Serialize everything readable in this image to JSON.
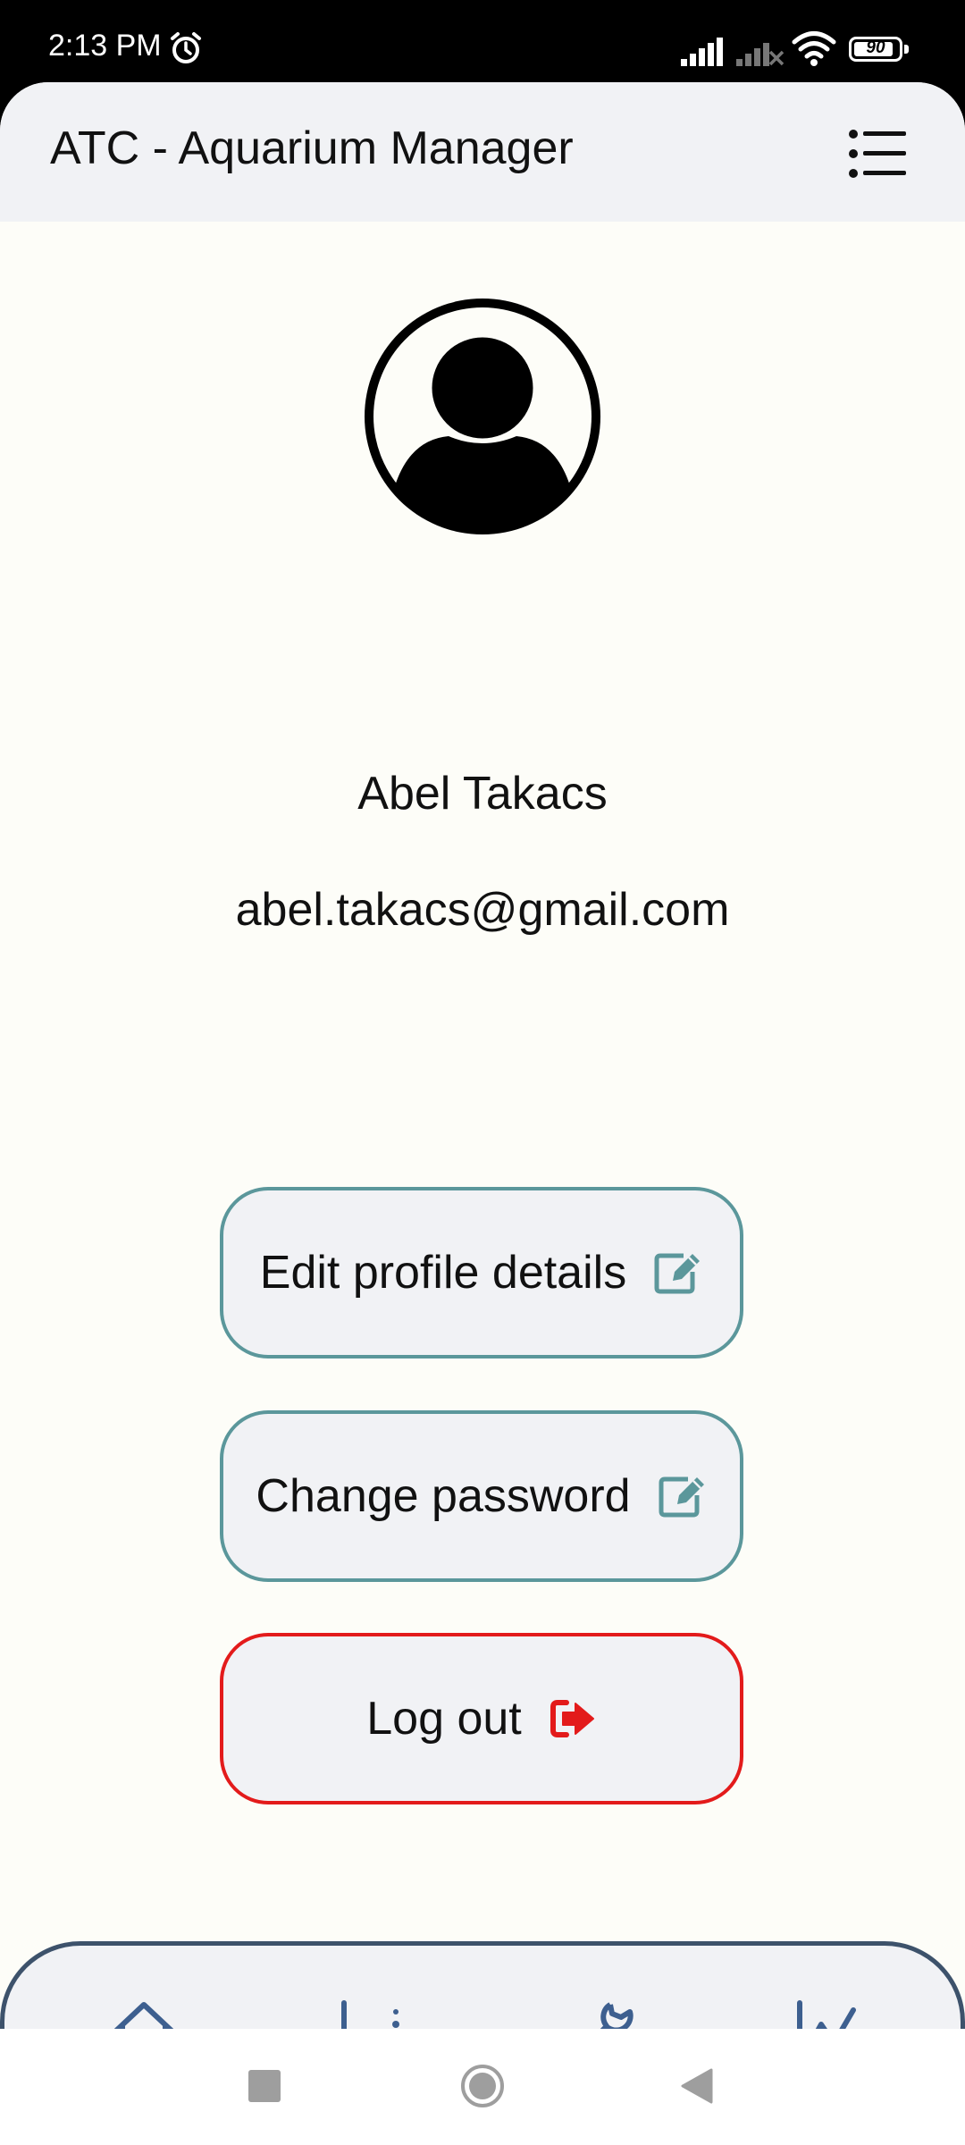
{
  "status_bar": {
    "time": "2:13 PM",
    "battery_level": "90",
    "icons": [
      "alarm-icon",
      "signal-icon",
      "signal-no-sim-icon",
      "wifi-icon",
      "battery-icon"
    ]
  },
  "header": {
    "title": "ATC - Aquarium Manager",
    "menu_icon": "list-menu-icon"
  },
  "profile": {
    "avatar_icon": "user-circle-icon",
    "name": "Abel Takacs",
    "email": "abel.takacs@gmail.com"
  },
  "actions": {
    "edit_profile": {
      "label": "Edit profile details",
      "icon": "edit-icon"
    },
    "change_password": {
      "label": "Change password",
      "icon": "edit-icon"
    },
    "logout": {
      "label": "Log out",
      "icon": "logout-icon"
    }
  },
  "bottom_nav": {
    "items": [
      {
        "name": "home",
        "icon": "home-icon"
      },
      {
        "name": "measurements",
        "icon": "scatter-chart-icon"
      },
      {
        "name": "maintenance",
        "icon": "wrench-icon"
      },
      {
        "name": "statistics",
        "icon": "line-chart-icon"
      }
    ]
  },
  "colors": {
    "accent_teal": "#5b979b",
    "danger_red": "#e31b1b",
    "nav_blue": "#3d5f8f",
    "surface": "#f1f2f5",
    "background": "#fdfdf8"
  }
}
